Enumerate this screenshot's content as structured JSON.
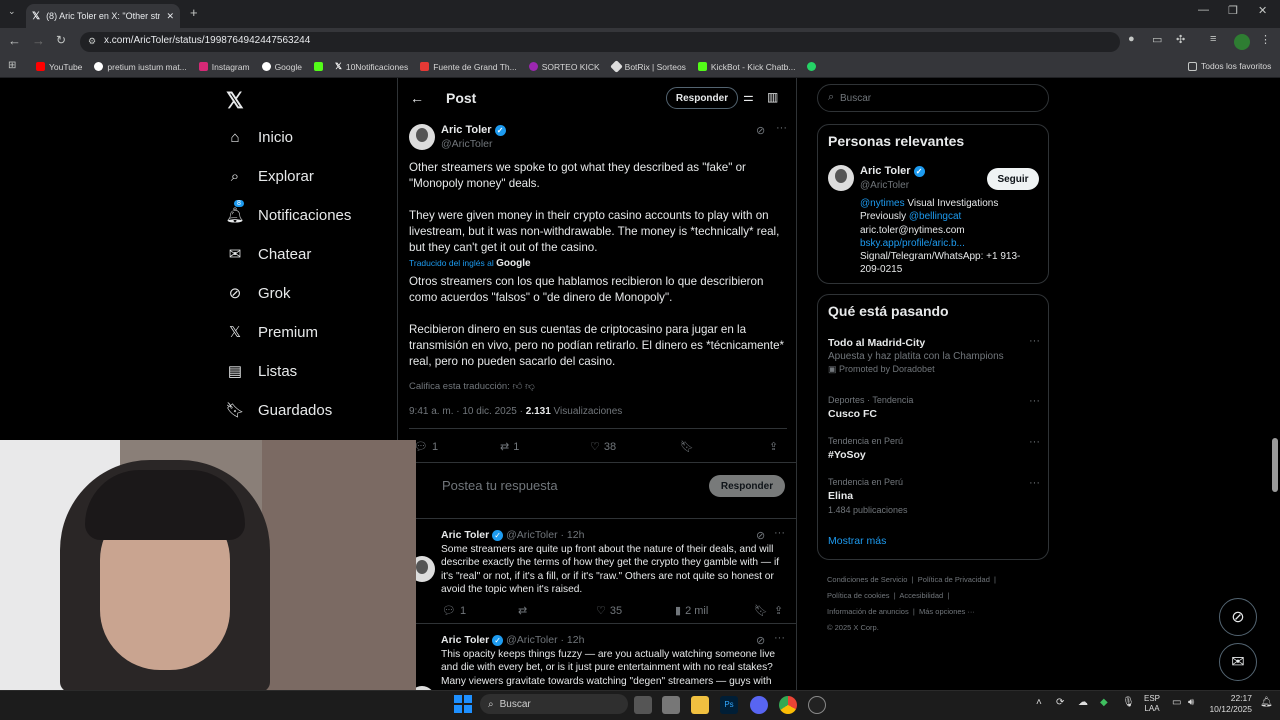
{
  "browser": {
    "tab_title": "(8) Aric Toler en X: \"Other strea",
    "url": "x.com/AricToler/status/1998764942447563244",
    "bookmarks": [
      "YouTube",
      "pretium iustum mat...",
      "Instagram",
      "Google",
      "10Notificaciones",
      "Fuente de Grand Th...",
      "SORTEO KICK",
      "BotRix | Sorteos",
      "KickBot - Kick Chatb..."
    ],
    "all_bookmarks": "Todos los favoritos"
  },
  "nav": {
    "items": [
      "Inicio",
      "Explorar",
      "Notificaciones",
      "Chatear",
      "Grok",
      "Premium",
      "Listas",
      "Guardados"
    ],
    "notif_badge": "8"
  },
  "header": {
    "title": "Post",
    "reply_button": "Responder"
  },
  "post": {
    "author": "Aric Toler",
    "handle": "@AricToler",
    "para1": "Other streamers we spoke to got what they described as \"fake\" or \"Monopoly money\" deals.",
    "para2": "They were given money in their crypto casino accounts to play with on livestream, but it was non-withdrawable. The money is *technically* real, but they can't get it out of the casino.",
    "translated_label": "Traducido del inglés al",
    "translated_by": "Google",
    "tr1": "Otros streamers con los que hablamos recibieron lo que describieron como acuerdos \"falsos\" o \"de dinero de Monopoly\".",
    "tr2": "Recibieron dinero en sus cuentas de criptocasino para jugar en la transmisión en vivo, pero no podían retirarlo. El dinero es *técnicamente* real, pero no pueden sacarlo del casino.",
    "rate": "Califica esta traducción:",
    "time": "9:41 a. m. · 10 dic. 2025 · ",
    "views_count": "2.131",
    "views_label": "Visualizaciones",
    "replies": "1",
    "reposts": "1",
    "likes": "38"
  },
  "compose": {
    "placeholder": "Postea tu respuesta",
    "button": "Responder"
  },
  "replies": [
    {
      "author": "Aric Toler",
      "handle": "@AricToler",
      "age": "· 12h",
      "text": "Some streamers are quite up front about the nature of their deals, and will describe exactly the terms of how they get the crypto they gamble with — if it's \"real\" or not, if it's a fill, or if it's \"raw.\" Others are not quite so honest or avoid the topic when it's raised.",
      "replies": "1",
      "likes": "35",
      "views": "2 mil"
    },
    {
      "author": "Aric Toler",
      "handle": "@AricToler",
      "age": "· 12h",
      "text": "This opacity keeps things fuzzy — are you actually watching someone live and die with every bet, or is it just pure entertainment with no real stakes? Many viewers gravitate towards watching \"degen\" streamers — guys with"
    }
  ],
  "search": {
    "placeholder": "Buscar"
  },
  "relevant": {
    "title": "Personas relevantes",
    "name": "Aric Toler",
    "handle": "@AricToler",
    "follow": "Seguir",
    "bio_link1": "@nytimes",
    "bio_text1": " Visual Investigations",
    "bio_pre2": "Previously ",
    "bio_link2": "@bellingcat",
    "bio_line3": "aric.toler@nytimes.com",
    "bio_link4": "bsky.app/profile/aric.b...",
    "bio_line5": "Signal/Telegram/WhatsApp: +1 913-209-0215"
  },
  "trends": {
    "title": "Qué está pasando",
    "items": [
      {
        "name": "Todo al Madrid-City",
        "meta": "Apuesta y haz platita con la Champions",
        "promo": "Promoted by Doradobet"
      },
      {
        "meta": "Deportes · Tendencia",
        "name": "Cusco FC"
      },
      {
        "meta": "Tendencia en Perú",
        "name": "#YoSoy"
      },
      {
        "meta": "Tendencia en Perú",
        "name": "Elina",
        "count": "1.484 publicaciones"
      }
    ],
    "more": "Mostrar más"
  },
  "footer": {
    "links": [
      "Condiciones de Servicio",
      "Política de Privacidad",
      "Política de cookies",
      "Accesibilidad",
      "Información de anuncios",
      "Más opciones ···"
    ],
    "copy": "© 2025 X Corp."
  },
  "taskbar": {
    "search": "Buscar",
    "lang1": "ESP",
    "lang2": "LAA",
    "time": "22:17",
    "date": "10/12/2025"
  },
  "colors": {
    "accent": "#1d9bf0",
    "bg": "#000000",
    "border": "#2f3336"
  }
}
